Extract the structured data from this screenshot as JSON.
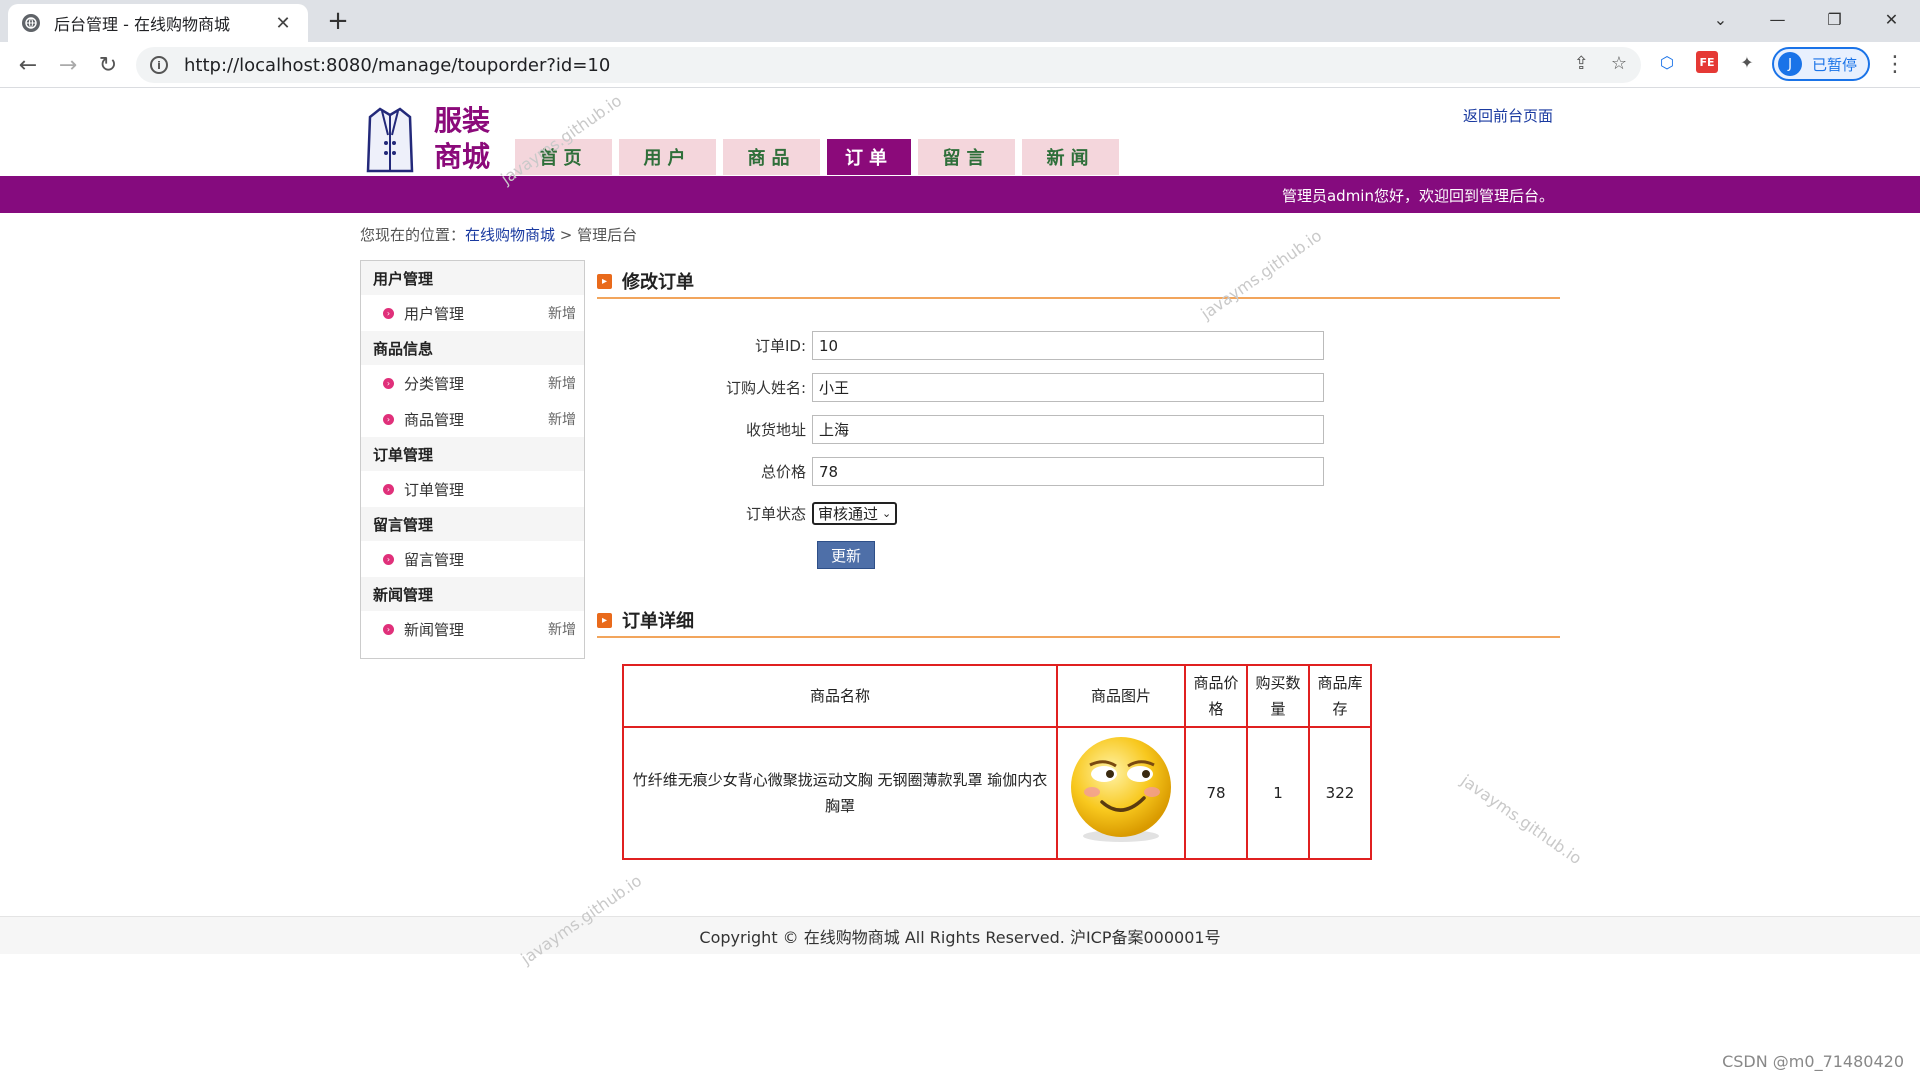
{
  "browser": {
    "tab_title": "后台管理 - 在线购物商城",
    "tab_close": "✕",
    "new_tab": "+",
    "url": "http://localhost:8080/manage/touporder?id=10",
    "profile_initial": "J",
    "profile_label": "已暂停",
    "window": {
      "minimize": "—",
      "restore": "❐",
      "close": "✕",
      "dropdown": "⌄"
    }
  },
  "header": {
    "logo_line1": "服装",
    "logo_line2": "商城",
    "back_link": "返回前台页面",
    "welcome": "管理员admin您好，欢迎回到管理后台。",
    "nav": [
      {
        "label": "首页"
      },
      {
        "label": "用户"
      },
      {
        "label": "商品"
      },
      {
        "label": "订单"
      },
      {
        "label": "留言"
      },
      {
        "label": "新闻"
      }
    ]
  },
  "breadcrumb": {
    "prefix": "您现在的位置：",
    "home": "在线购物商城",
    "sep": " > ",
    "current": "管理后台"
  },
  "sidebar": {
    "groups": [
      {
        "title": "用户管理",
        "items": [
          {
            "label": "用户管理",
            "action": "新增"
          }
        ]
      },
      {
        "title": "商品信息",
        "items": [
          {
            "label": "分类管理",
            "action": "新增"
          },
          {
            "label": "商品管理",
            "action": "新增"
          }
        ]
      },
      {
        "title": "订单管理",
        "items": [
          {
            "label": "订单管理",
            "action": ""
          }
        ]
      },
      {
        "title": "留言管理",
        "items": [
          {
            "label": "留言管理",
            "action": ""
          }
        ]
      },
      {
        "title": "新闻管理",
        "items": [
          {
            "label": "新闻管理",
            "action": "新增"
          }
        ]
      }
    ]
  },
  "edit_order": {
    "title": "修改订单",
    "fields": {
      "order_id_label": "订单ID:",
      "order_id": "10",
      "buyer_label": "订购人姓名:",
      "buyer": "小王",
      "address_label": "收货地址",
      "address": "上海",
      "total_label": "总价格",
      "total": "78",
      "status_label": "订单状态",
      "status": "审核通过"
    },
    "update_button": "更新"
  },
  "order_detail": {
    "title": "订单详细",
    "columns": [
      "商品名称",
      "商品图片",
      "商品价格",
      "购买数量",
      "商品库存"
    ],
    "rows": [
      {
        "name": "竹纤维无痕少女背心微聚拢运动文胸 无钢圈薄款乳罩 瑜伽内衣胸罩",
        "image": "smiley-icon",
        "price": "78",
        "quantity": "1",
        "stock": "322"
      }
    ]
  },
  "footer": {
    "text": "Copyright © 在线购物商城 All Rights Reserved. 沪ICP备案000001号"
  },
  "watermark": "javayms.github.io",
  "csdn": "CSDN @m0_71480420",
  "colors": {
    "brand_purple": "#850b7e",
    "nav_pink": "#f4d6dc",
    "accent_orange": "#f2a55c",
    "table_red": "#e02020"
  }
}
